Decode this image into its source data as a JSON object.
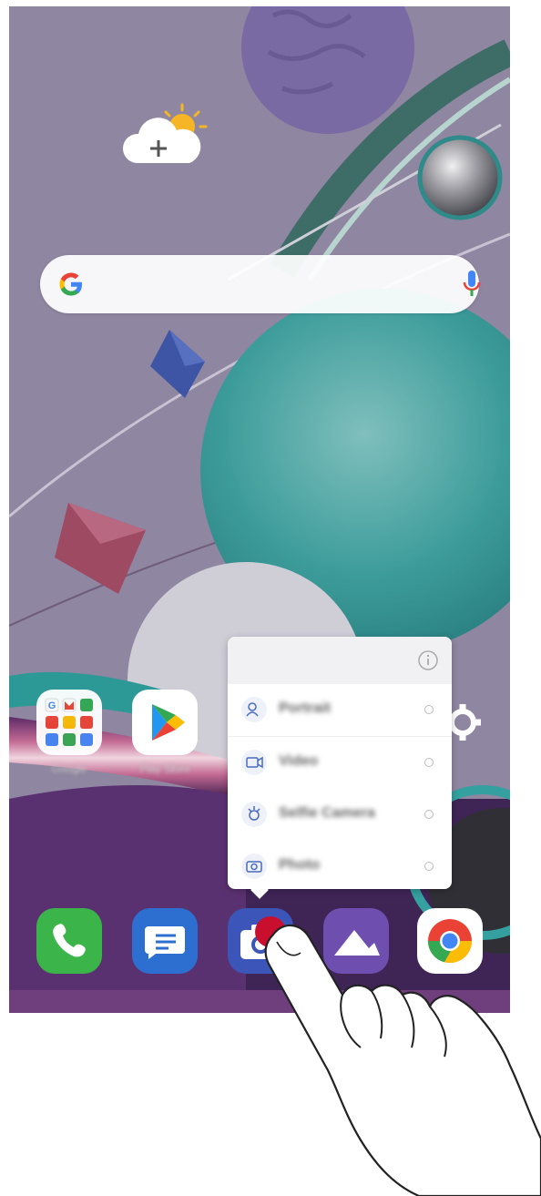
{
  "search": {
    "placeholder": "",
    "logo_icon": "google-g-logo",
    "mic_icon": "microphone-icon"
  },
  "weather_widget": {
    "icon": "cloud-sun-add-icon"
  },
  "home_apps": [
    {
      "name": "Google",
      "icon": "google-apps-folder-icon"
    },
    {
      "name": "Play Store",
      "icon": "play-store-icon"
    },
    {
      "name": "Camera",
      "icon": "camera-icon"
    },
    {
      "name": "Settings",
      "icon": "gear-icon"
    }
  ],
  "shortcut_popup": {
    "info_icon": "info-icon",
    "items": [
      {
        "label": "Portrait",
        "icon": "portrait-mode-icon"
      },
      {
        "label": "Video",
        "icon": "video-camera-icon"
      },
      {
        "label": "Selfie Camera",
        "icon": "selfie-camera-icon"
      },
      {
        "label": "Photo",
        "icon": "photo-camera-icon"
      }
    ]
  },
  "dock": [
    {
      "name": "Phone",
      "icon": "phone-icon",
      "color": "#3bb54a"
    },
    {
      "name": "Messages",
      "icon": "message-icon",
      "color": "#2d6fd0"
    },
    {
      "name": "Camera",
      "icon": "camera-icon",
      "color": "#3b55b8"
    },
    {
      "name": "Gallery",
      "icon": "gallery-mountain-icon",
      "color": "#6e4fb0"
    },
    {
      "name": "Chrome",
      "icon": "chrome-icon",
      "color": "#ffffff"
    }
  ],
  "colors": {
    "wallpaper": "#8f86a1",
    "popup_background": "#ffffff",
    "popup_header": "#f1f1f3"
  }
}
